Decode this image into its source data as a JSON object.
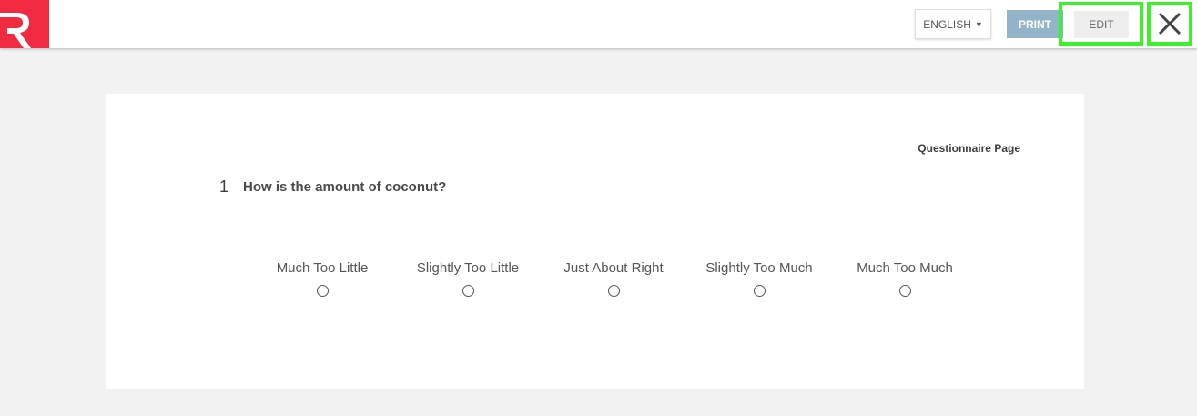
{
  "header": {
    "logo_letter": "R",
    "language_label": "ENGLISH",
    "print_label": "PRINT",
    "edit_label": "EDIT",
    "close_icon": "close-icon",
    "colors": {
      "logo": "#f02a40",
      "print": "#92b4c8",
      "highlight": "#3cf02c"
    }
  },
  "card": {
    "page_label": "Questionnaire Page",
    "question_number": "1",
    "question_text": "How is the amount of coconut?",
    "options": [
      {
        "label": "Much Too Little",
        "selected": false
      },
      {
        "label": "Slightly Too Little",
        "selected": false
      },
      {
        "label": "Just About Right",
        "selected": false
      },
      {
        "label": "Slightly Too Much",
        "selected": false
      },
      {
        "label": "Much Too Much",
        "selected": false
      }
    ]
  }
}
